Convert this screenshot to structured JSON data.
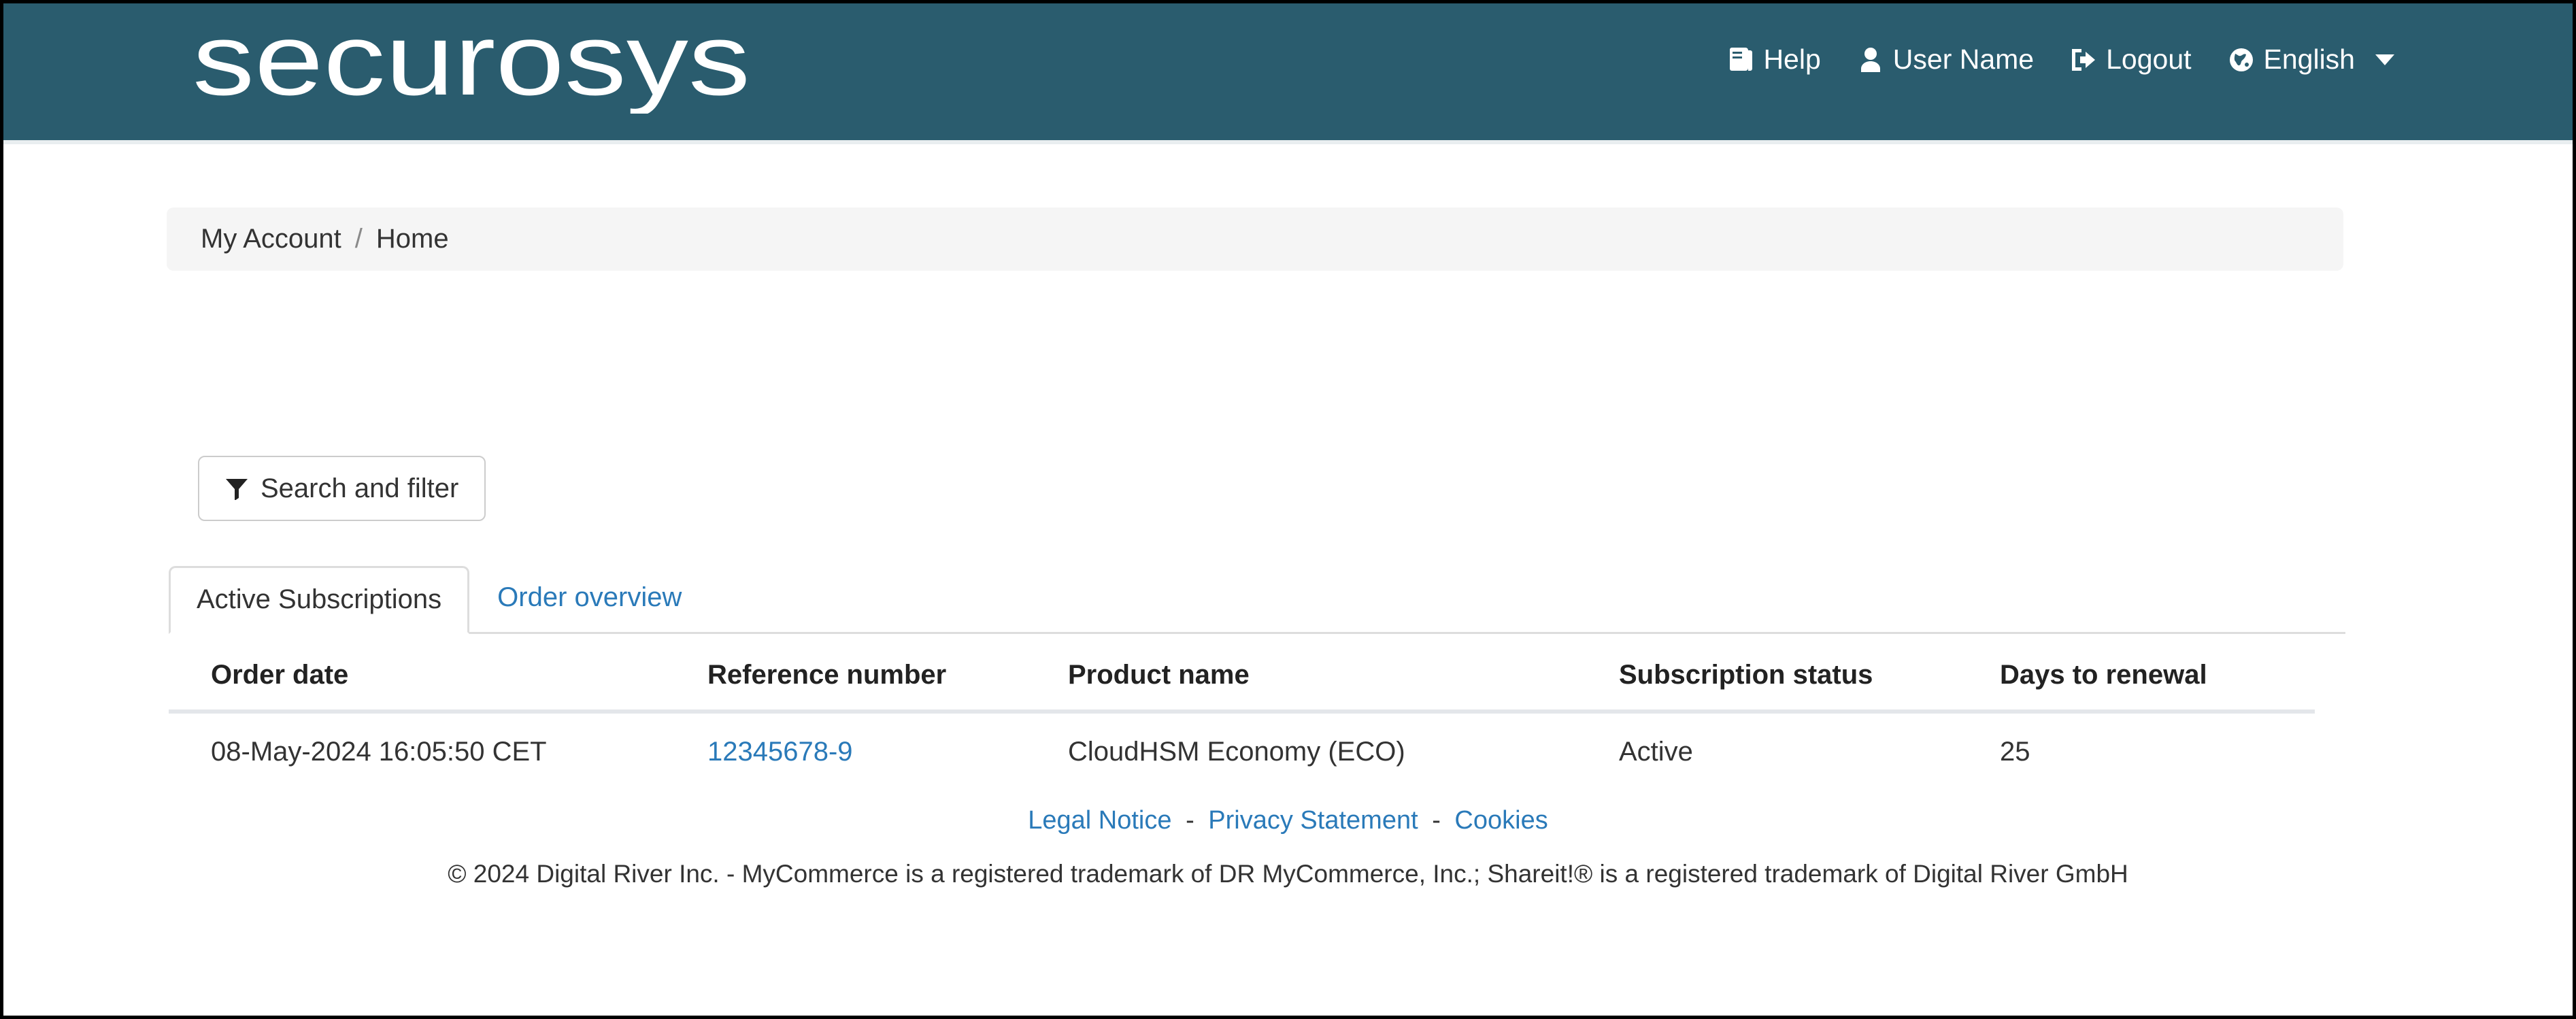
{
  "theme": {
    "header_bg": "#2a5c6e",
    "link_blue": "#2a7ab9",
    "text_dark": "#333333",
    "breadcrumb_bg": "#f5f5f5",
    "border_gray": "#dddddd"
  },
  "header": {
    "logo_text": "securosys",
    "nav": [
      {
        "label": "Help",
        "icon": "book-icon"
      },
      {
        "label": "User Name",
        "icon": "user-icon"
      },
      {
        "label": "Logout",
        "icon": "sign-out-icon"
      },
      {
        "label": "English",
        "icon": "globe-icon",
        "caret": "chevron-down-icon"
      }
    ]
  },
  "breadcrumb": {
    "root": "My Account",
    "separator": "/",
    "current": "Home"
  },
  "toolbar": {
    "filter_label": "Search and filter",
    "filter_icon": "funnel-icon"
  },
  "tabs": [
    {
      "label": "Active Subscriptions",
      "active": true
    },
    {
      "label": "Order overview",
      "active": false
    }
  ],
  "table": {
    "columns": [
      "Order date",
      "Reference number",
      "Product name",
      "Subscription status",
      "Days to renewal"
    ],
    "rows": [
      {
        "order_date": "08-May-2024 16:05:50 CET",
        "reference_number": "12345678-9",
        "product_name": "CloudHSM Economy (ECO)",
        "subscription_status": "Active",
        "days_to_renewal": "25"
      }
    ]
  },
  "footer": {
    "links": [
      {
        "label": "Legal Notice"
      },
      {
        "label": "Privacy Statement"
      },
      {
        "label": "Cookies"
      }
    ],
    "separator": "-",
    "copyright": "© 2024 Digital River Inc. - MyCommerce is a registered trademark of DR MyCommerce, Inc.; Shareit!® is a registered trademark of Digital River GmbH"
  }
}
